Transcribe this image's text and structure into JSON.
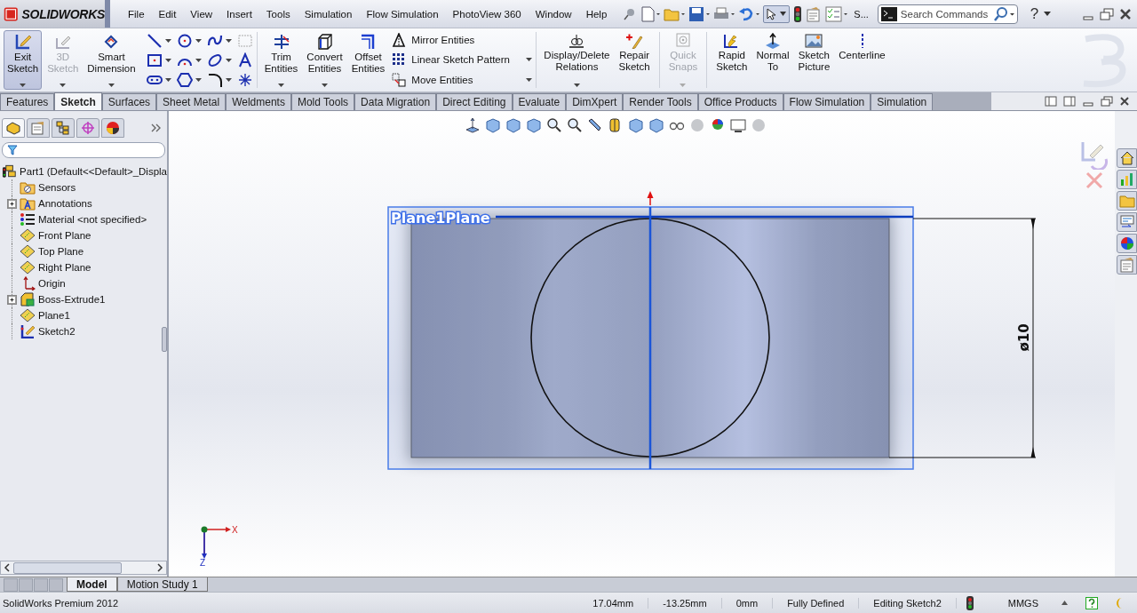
{
  "app": {
    "logo": "SOLIDWORKS",
    "menu": [
      {
        "label": "File"
      },
      {
        "label": "Edit"
      },
      {
        "label": "View"
      },
      {
        "label": "Insert"
      },
      {
        "label": "Tools"
      },
      {
        "label": "Simulation"
      },
      {
        "label": "Flow Simulation"
      },
      {
        "label": "PhotoView 360"
      },
      {
        "label": "Window"
      },
      {
        "label": "Help"
      }
    ],
    "overflow_label": "S...",
    "search": {
      "placeholder": "Search Commands"
    },
    "help_label": "?"
  },
  "ribbon": {
    "sketch_buttons": [
      {
        "label": "Exit Sketch",
        "active": true,
        "disabled": false
      },
      {
        "label": "3D Sketch",
        "active": false,
        "disabled": true
      },
      {
        "label": "Smart Dimension",
        "active": false,
        "disabled": false
      }
    ],
    "edit_buttons": [
      {
        "label": "Trim Entities"
      },
      {
        "label": "Convert Entities"
      },
      {
        "label": "Offset Entities"
      }
    ],
    "list_buttons": [
      {
        "label": "Mirror Entities"
      },
      {
        "label": "Linear Sketch Pattern"
      },
      {
        "label": "Move Entities"
      }
    ],
    "more_buttons": [
      {
        "label": "Display/Delete Relations",
        "disabled": false
      },
      {
        "label": "Repair Sketch",
        "disabled": false
      },
      {
        "label": "Quick Snaps",
        "disabled": true
      },
      {
        "label": "Rapid Sketch",
        "disabled": false
      },
      {
        "label": "Normal To",
        "disabled": false
      },
      {
        "label": "Sketch Picture",
        "disabled": false
      },
      {
        "label": "Centerline",
        "disabled": false
      }
    ]
  },
  "tabs": [
    {
      "label": "Features",
      "selected": false
    },
    {
      "label": "Sketch",
      "selected": true
    },
    {
      "label": "Surfaces",
      "selected": false
    },
    {
      "label": "Sheet Metal",
      "selected": false
    },
    {
      "label": "Weldments",
      "selected": false
    },
    {
      "label": "Mold Tools",
      "selected": false
    },
    {
      "label": "Data Migration",
      "selected": false
    },
    {
      "label": "Direct Editing",
      "selected": false
    },
    {
      "label": "Evaluate",
      "selected": false
    },
    {
      "label": "DimXpert",
      "selected": false
    },
    {
      "label": "Render Tools",
      "selected": false
    },
    {
      "label": "Office Products",
      "selected": false
    },
    {
      "label": "Flow Simulation",
      "selected": false
    },
    {
      "label": "Simulation",
      "selected": false
    }
  ],
  "panel_tabs": [
    {
      "selected": true
    },
    {
      "selected": false
    },
    {
      "selected": false
    },
    {
      "selected": false
    },
    {
      "selected": false
    }
  ],
  "feature_tree": {
    "label": "Part1  (Default<<Default>_Displa",
    "children": [
      {
        "label": "Sensors"
      },
      {
        "label": "Annotations",
        "expanded": false
      },
      {
        "label": "Material <not specified>"
      },
      {
        "label": "Front Plane"
      },
      {
        "label": "Top Plane"
      },
      {
        "label": "Right Plane"
      },
      {
        "label": "Origin"
      },
      {
        "label": "Boss-Extrude1",
        "expanded": false
      },
      {
        "label": "Plane1"
      },
      {
        "label": "Sketch2"
      }
    ]
  },
  "viewport": {
    "plane_label": "Plane1Plane",
    "dimension": "ø10",
    "axis_x": "X",
    "axis_z": "Z"
  },
  "bottom_tabs": [
    {
      "label": "Model",
      "selected": true
    },
    {
      "label": "Motion Study 1",
      "selected": false
    }
  ],
  "status_bar": {
    "product": "SolidWorks Premium 2012",
    "fields": [
      "17.04mm",
      "-13.25mm",
      "0mm",
      "Fully Defined",
      "Editing Sketch2"
    ],
    "units": "MMGS"
  }
}
